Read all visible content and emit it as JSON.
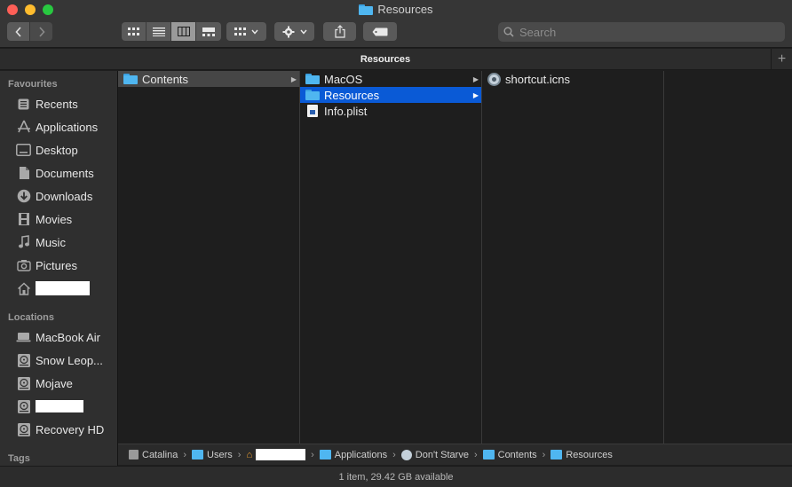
{
  "window": {
    "title": "Resources"
  },
  "toolbar": {
    "back_icon": "chevron-left-icon",
    "forward_icon": "chevron-right-icon",
    "view_modes": [
      "icon-view",
      "list-view",
      "column-view",
      "gallery-view"
    ],
    "active_view": "column-view",
    "search_placeholder": "Search"
  },
  "tabbar": {
    "title": "Resources",
    "add_label": "+"
  },
  "sidebar": {
    "favourites_heading": "Favourites",
    "favourites": [
      {
        "label": "Recents",
        "icon": "clock-icon"
      },
      {
        "label": "Applications",
        "icon": "applications-icon"
      },
      {
        "label": "Desktop",
        "icon": "desktop-icon"
      },
      {
        "label": "Documents",
        "icon": "document-icon"
      },
      {
        "label": "Downloads",
        "icon": "download-icon"
      },
      {
        "label": "Movies",
        "icon": "film-icon"
      },
      {
        "label": "Music",
        "icon": "music-note-icon"
      },
      {
        "label": "Pictures",
        "icon": "camera-icon"
      },
      {
        "label": "",
        "icon": "home-icon"
      }
    ],
    "locations_heading": "Locations",
    "locations": [
      {
        "label": "MacBook Air",
        "icon": "laptop-icon"
      },
      {
        "label": "Snow Leop...",
        "icon": "disk-icon"
      },
      {
        "label": "Mojave",
        "icon": "disk-icon"
      },
      {
        "label": "",
        "icon": "disk-icon"
      },
      {
        "label": "Recovery HD",
        "icon": "disk-icon"
      }
    ],
    "tags_heading": "Tags"
  },
  "columns": {
    "col1": [
      {
        "label": "Contents",
        "icon": "folder-icon",
        "has_children": true,
        "selected": "grey"
      }
    ],
    "col2": [
      {
        "label": "MacOS",
        "icon": "folder-icon",
        "has_children": true,
        "selected": ""
      },
      {
        "label": "Resources",
        "icon": "folder-icon",
        "has_children": true,
        "selected": "blue"
      },
      {
        "label": "Info.plist",
        "icon": "plist-file-icon",
        "has_children": false,
        "selected": ""
      }
    ],
    "col3": [
      {
        "label": "shortcut.icns",
        "icon": "icns-file-icon",
        "has_children": false,
        "selected": ""
      }
    ]
  },
  "pathbar": [
    {
      "label": "Catalina",
      "icon": "disk-icon"
    },
    {
      "label": "Users",
      "icon": "users-folder-icon"
    },
    {
      "label": "",
      "icon": "home-icon"
    },
    {
      "label": "Applications",
      "icon": "applications-folder-icon"
    },
    {
      "label": "Don't Starve",
      "icon": "app-icon"
    },
    {
      "label": "Contents",
      "icon": "folder-icon"
    },
    {
      "label": "Resources",
      "icon": "folder-icon"
    }
  ],
  "statusbar": {
    "text": "1 item, 29.42 GB available"
  },
  "colors": {
    "selection_blue": "#0a5ad6",
    "folder_blue": "#4fb6f0"
  }
}
